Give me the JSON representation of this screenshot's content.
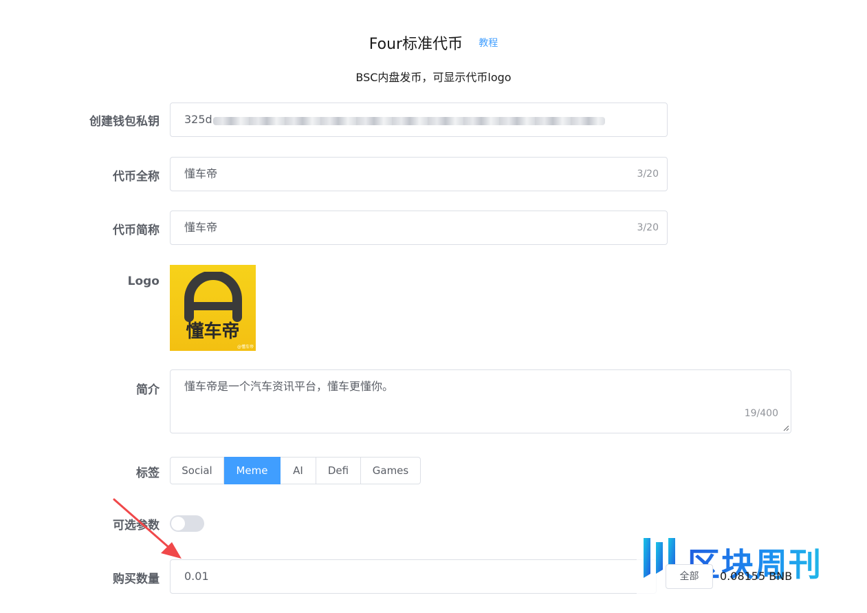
{
  "header": {
    "title": "Four标准代币",
    "tutorial_link": "教程",
    "subtitle": "BSC内盘发币，可显示代币logo"
  },
  "form": {
    "private_key": {
      "label": "创建钱包私钥",
      "value_visible": "325d"
    },
    "token_name": {
      "label": "代币全称",
      "value": "懂车帝",
      "count": "3/20"
    },
    "token_symbol": {
      "label": "代币简称",
      "value": "懂车帝",
      "count": "3/20"
    },
    "logo": {
      "label": "Logo",
      "image_text": "懂车帝",
      "image_watermark": "@懂车帝"
    },
    "description": {
      "label": "简介",
      "value": "懂车帝是一个汽车资讯平台，懂车更懂你。",
      "count": "19/400"
    },
    "tags": {
      "label": "标签",
      "options": [
        "Social",
        "Meme",
        "AI",
        "Defi",
        "Games"
      ],
      "selected": "Meme"
    },
    "optional_params": {
      "label": "可选参数",
      "enabled": false
    },
    "buy_amount": {
      "label": "购买数量",
      "value": "0.01",
      "all_button": "全部",
      "balance": "0.08155 BNB"
    }
  },
  "colors": {
    "accent": "#409eff",
    "border": "#dcdfe6",
    "label": "#5a5e66",
    "arrow": "#f0484a",
    "logo_bg": "#f5c817"
  },
  "watermark": {
    "text": "区块周刊"
  }
}
